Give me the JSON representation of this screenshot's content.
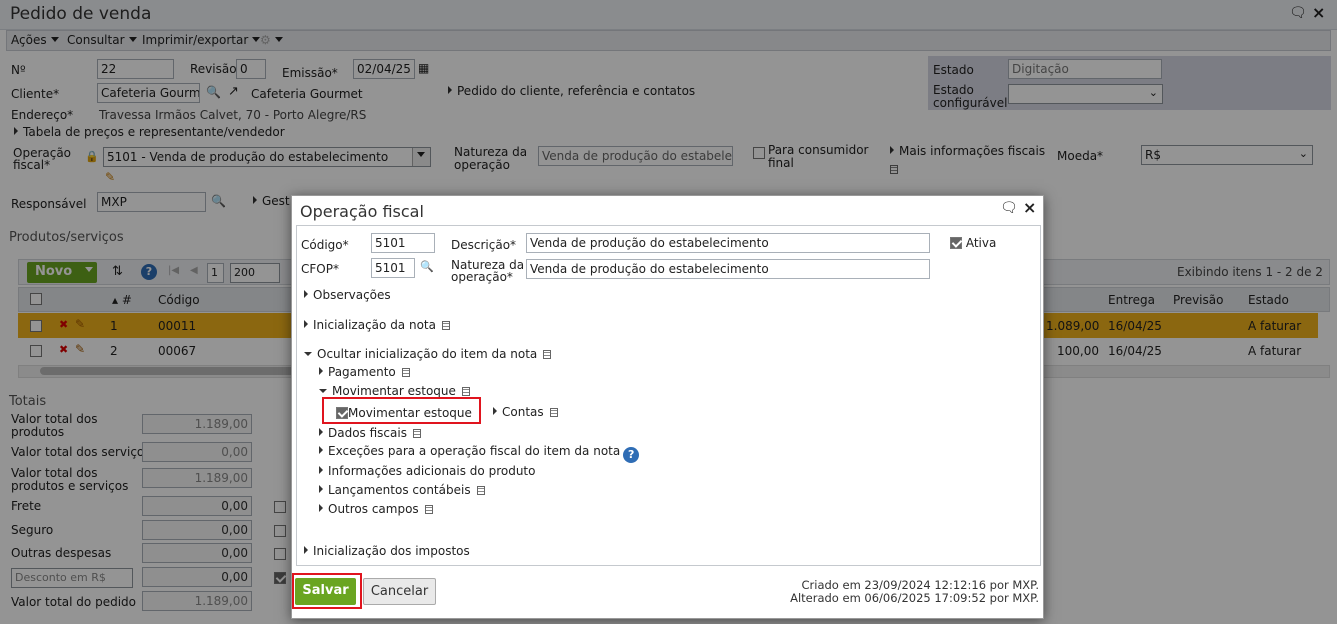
{
  "window": {
    "title": "Pedido de venda"
  },
  "menu": {
    "acoes": "Ações",
    "consultar": "Consultar",
    "imprimir": "Imprimir/exportar"
  },
  "header": {
    "numero_label": "Nº",
    "numero": "22",
    "revisao_label": "Revisão",
    "revisao": "0",
    "emissao_label": "Emissão*",
    "emissao": "02/04/25",
    "cliente_label": "Cliente*",
    "cliente": "Cafeteria Gourmet",
    "cliente_link": "Cafeteria Gourmet",
    "pedido_cliente_link": "Pedido do cliente, referência e contatos",
    "endereco_label": "Endereço*",
    "endereco": "Travessa Irmãos Calvet, 70 - Porto Alegre/RS",
    "tabela_precos_link": "Tabela de preços e representante/vendedor",
    "estado_label": "Estado",
    "estado": "Digitação",
    "estado_conf_label_1": "Estado",
    "estado_conf_label_2": "configurável",
    "operacao_fiscal_label_1": "Operação",
    "operacao_fiscal_label_2": "fiscal*",
    "operacao_fiscal": "5101 - Venda de produção do estabelecimento",
    "natureza_label_1": "Natureza da",
    "natureza_label_2": "operação",
    "natureza": "Venda de produção do estabelecime",
    "consumidor_final_1": "Para consumidor",
    "consumidor_final_2": "final",
    "mais_info_fiscais": "Mais informações fiscais",
    "moeda_label": "Moeda*",
    "moeda": "R$",
    "responsavel_label": "Responsável",
    "responsavel": "MXP",
    "gest": "Gest"
  },
  "produtos": {
    "title": "Produtos/serviços",
    "novo": "Novo",
    "page": "1",
    "page_size": "200",
    "exibindo": "Exibindo itens 1 - 2 de 2",
    "columns": {
      "num": "#",
      "codigo": "Código",
      "entrega": "Entrega",
      "previsao": "Previsão",
      "estado": "Estado"
    },
    "rows": [
      {
        "num": "1",
        "codigo": "00011",
        "valor": "1.089,00",
        "entrega": "16/04/25",
        "previsao": "",
        "estado": "A faturar"
      },
      {
        "num": "2",
        "codigo": "00067",
        "valor": "100,00",
        "entrega": "16/04/25",
        "previsao": "",
        "estado": "A faturar"
      }
    ]
  },
  "totais": {
    "title": "Totais",
    "items": [
      {
        "label1": "Valor total dos",
        "label2": "produtos",
        "value": "1.189,00"
      },
      {
        "label1": "Valor total dos serviços",
        "label2": "",
        "value": "0,00"
      },
      {
        "label1": "Valor total dos",
        "label2": "produtos e serviços",
        "value": "1.189,00"
      },
      {
        "label1": "Frete",
        "label2": "",
        "value": "0,00"
      },
      {
        "label1": "Seguro",
        "label2": "",
        "value": "0,00"
      },
      {
        "label1": "Outras despesas",
        "label2": "",
        "value": "0,00"
      }
    ],
    "desconto_select": "Desconto em R$",
    "desconto_value": "0,00",
    "total_pedido_label": "Valor total do pedido",
    "total_pedido": "1.189,00"
  },
  "dialog": {
    "title": "Operação fiscal",
    "codigo_label": "Código*",
    "codigo": "5101",
    "descricao_label": "Descrição*",
    "descricao": "Venda de produção do estabelecimento",
    "ativa_label": "Ativa",
    "cfop_label": "CFOP*",
    "cfop": "5101",
    "natureza_label_1": "Natureza da",
    "natureza_label_2": "operação*",
    "natureza": "Venda de produção do estabelecimento",
    "observacoes": "Observações",
    "inicializacao_nota": "Inicialização da nota",
    "ocultar_item": "Ocultar inicialização do item da nota",
    "pagamento": "Pagamento",
    "movimentar_estoque_section": "Movimentar estoque",
    "movimentar_estoque_check": "Movimentar estoque",
    "contas": "Contas",
    "dados_fiscais": "Dados fiscais",
    "excecoes": "Exceções para a operação fiscal do item da nota",
    "info_adicionais": "Informações adicionais do produto",
    "lancamentos": "Lançamentos contábeis",
    "outros_campos": "Outros campos",
    "inicializacao_impostos": "Inicialização dos impostos",
    "salvar": "Salvar",
    "cancelar": "Cancelar",
    "criado": "Criado em 23/09/2024 12:12:16 por MXP.",
    "alterado": "Alterado em 06/06/2025 17:09:52 por MXP."
  },
  "colors": {
    "accent_green": "#6aa521",
    "highlight_row": "#f0b21c",
    "red_box": "#e0141e"
  }
}
